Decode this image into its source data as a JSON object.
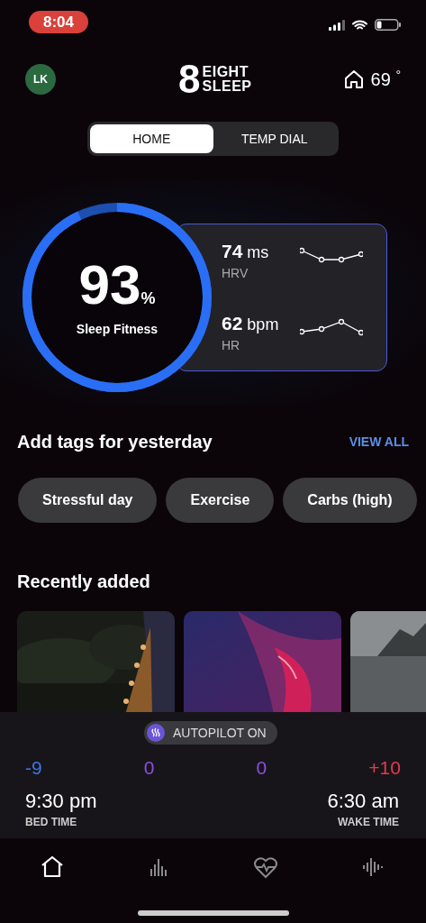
{
  "status_bar": {
    "time": "8:04"
  },
  "header": {
    "avatar": "LK",
    "logo": {
      "mark": "8",
      "line1": "EIGHT",
      "line2": "SLEEP"
    },
    "temperature": "69",
    "unit": "°"
  },
  "tabs": [
    {
      "label": "HOME",
      "selected": true
    },
    {
      "label": "TEMP DIAL",
      "selected": false
    }
  ],
  "sleep_fitness": {
    "value": "93",
    "unit": "%",
    "label": "Sleep Fitness",
    "level": 0.93
  },
  "metrics": [
    {
      "value": "74",
      "unit": "ms",
      "label": "HRV"
    },
    {
      "value": "62",
      "unit": "bpm",
      "label": "HR"
    }
  ],
  "tags": {
    "title": "Add tags for yesterday",
    "action": "VIEW ALL",
    "items": [
      "Stressful day",
      "Exercise",
      "Carbs (high)"
    ]
  },
  "recent": {
    "title": "Recently added"
  },
  "autopilot": {
    "label": "AUTOPILOT ON",
    "on": true
  },
  "temperature_levels": [
    {
      "value": "-9",
      "color": "#3d74e6"
    },
    {
      "value": "0",
      "color": "#8a4fe0"
    },
    {
      "value": "0",
      "color": "#8a4fe0"
    },
    {
      "value": "+10",
      "color": "#e23a4f"
    }
  ],
  "schedule": {
    "bed_time": "9:30 pm",
    "bed_label": "BED TIME",
    "wake_time": "6:30 am",
    "wake_label": "WAKE TIME"
  },
  "nav": [
    {
      "kind": "home",
      "selected": true
    },
    {
      "kind": "stats",
      "selected": false
    },
    {
      "kind": "health",
      "selected": false
    },
    {
      "kind": "sound",
      "selected": false
    }
  ]
}
